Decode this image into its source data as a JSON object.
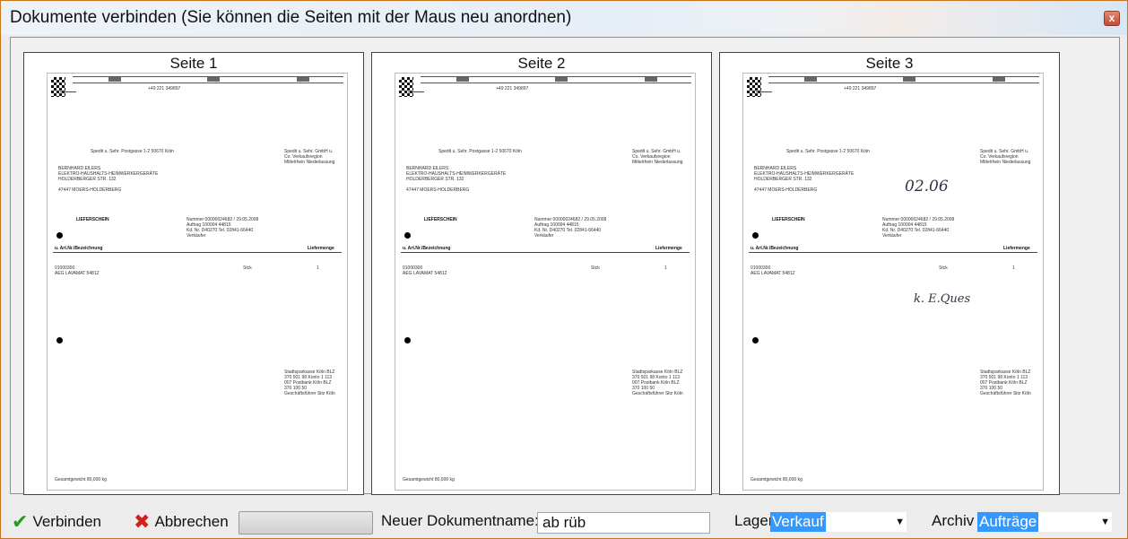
{
  "window": {
    "title": "Dokumente verbinden (Sie können die Seiten mit der Maus neu anordnen)",
    "close_glyph": "x"
  },
  "pages": [
    {
      "label": "Seite 1",
      "doc": {
        "phone": "+49 221 349897",
        "address_small": "Spedit u. Sehr. Postgasse 1-2  50670 Köln",
        "recipient_1": "BERNHARD EILERS",
        "recipient_2": "ELEKTRO-HAUSHALTS-HEIMWERKERGERÄTE",
        "recipient_3": "HOLDERBERGER STR. 132",
        "recipient_4": "47447 MOERS-HOLDERBERG",
        "doc_type": "LIEFERSCHEIN",
        "meta_1": "Nummer   00000024682 /  29.05.2008",
        "meta_2": "Auftrag    100004 44815",
        "meta_3": "Kd. Nr.    D40270    Tel. 02841-66440",
        "meta_4": "Verkäufer",
        "col_left": "u.   Art.Nr./Bezeichnung",
        "col_right": "Liefermenge",
        "item_1": "01000300",
        "item_2": "AEG LAVAMAT 54812",
        "item_unit": "Stck",
        "item_qty": "1",
        "footer": "Gesamtgewicht          80,000  kg",
        "handwriting_1": "",
        "handwriting_2": ""
      }
    },
    {
      "label": "Seite 2",
      "doc": {
        "phone": "+49 221 349897",
        "address_small": "Spedit u. Sehr. Postgasse 1-2  50670 Köln",
        "recipient_1": "BERNHARD EILERS",
        "recipient_2": "ELEKTRO-HAUSHALTS-HEIMWERKERGERÄTE",
        "recipient_3": "HOLDERBERGER STR. 132",
        "recipient_4": "47447 MOERS-HOLDERBERG",
        "doc_type": "LIEFERSCHEIN",
        "meta_1": "Nummer   00000024682 /  29.05.2008",
        "meta_2": "Auftrag    100004 44815",
        "meta_3": "Kd. Nr.    D40270    Tel. 02841-66440",
        "meta_4": "Verkäufer",
        "col_left": "u.   Art.Nr./Bezeichnung",
        "col_right": "Liefermenge",
        "item_1": "01000300",
        "item_2": "AEG LAVAMAT 54812",
        "item_unit": "Stck",
        "item_qty": "1",
        "footer": "Gesamtgewicht          80,000  kg",
        "handwriting_1": "",
        "handwriting_2": ""
      }
    },
    {
      "label": "Seite 3",
      "doc": {
        "phone": "+49 221 349897",
        "address_small": "Spedit u. Sehr. Postgasse 1-2  50670 Köln",
        "recipient_1": "BERNHARD EILERS",
        "recipient_2": "ELEKTRO-HAUSHALTS-HEIMWERKERGERÄTE",
        "recipient_3": "HOLDERBERGER STR. 132",
        "recipient_4": "47447 MOERS-HOLDERBERG",
        "doc_type": "LIEFERSCHEIN",
        "meta_1": "Nummer   00000024682 /  29.05.2008",
        "meta_2": "Auftrag    100004 44815",
        "meta_3": "Kd. Nr.    D40270    Tel. 02841-66440",
        "meta_4": "Verkäufer",
        "col_left": "u.   Art.Nr./Bezeichnung",
        "col_right": "Liefermenge",
        "item_1": "01000300",
        "item_2": "AEG LAVAMAT 54812",
        "item_unit": "Stck",
        "item_qty": "1",
        "footer": "Gesamtgewicht          80,000  kg",
        "handwriting_1": "02.06",
        "handwriting_2": "k. E.Ques"
      }
    }
  ],
  "toolbar": {
    "verbinden_label": "Verbinden",
    "abbrechen_label": "Abbrechen",
    "docname_label": "Neuer Dokumentname:",
    "docname_value": "ab rüb",
    "lager_label": "Lager:",
    "lager_value": "Verkauf",
    "archiv_label": "Archiv",
    "archiv_value": "Aufträge",
    "check_glyph": "✔",
    "cross_glyph": "✖",
    "dropdown_glyph": "▼"
  },
  "colors": {
    "check": "#2a9a1f",
    "cross": "#d0201a",
    "selection": "#3399ff",
    "window_border": "#c9731f"
  }
}
